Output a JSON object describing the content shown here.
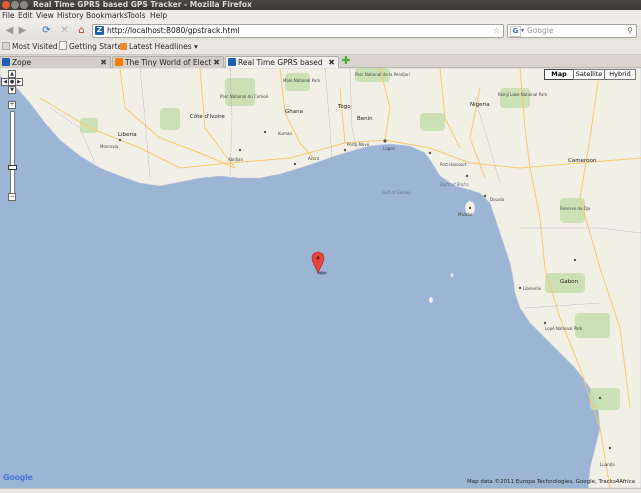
{
  "window": {
    "title": "Real Time GPRS based GPS Tracker - Mozilla Firefox"
  },
  "menu": [
    "File",
    "Edit",
    "View",
    "History",
    "Bookmarks",
    "Tools",
    "Help"
  ],
  "nav": {
    "url": "http://localhost:8080/gpstrack.html",
    "search_placeholder": "Google"
  },
  "bookmarks": [
    {
      "label": "Most Visited",
      "icon": "most-visited-icon",
      "has_dropdown": true
    },
    {
      "label": "Getting Started",
      "icon": "page-icon",
      "has_dropdown": false
    },
    {
      "label": "Latest Headlines",
      "icon": "rss-icon",
      "has_dropdown": true
    }
  ],
  "tabs": [
    {
      "label": "Zope",
      "icon": "zope-icon",
      "active": false
    },
    {
      "label": "The Tiny World of Electron...",
      "icon": "blogger-icon",
      "active": false
    },
    {
      "label": "Real Time GPRS based GP...",
      "icon": "gps-page-icon",
      "active": true
    }
  ],
  "map": {
    "type_buttons": [
      {
        "label": "Map",
        "selected": true
      },
      {
        "label": "Satellite",
        "selected": false
      },
      {
        "label": "Hybrid",
        "selected": false
      }
    ],
    "logo": "Google",
    "credit": "Map data ©2011 Europa Technologies, Google, Tracks4Africa",
    "zoom_level_fraction": 0.35,
    "colors": {
      "water": "#9db5d5",
      "land": "#f2efe6",
      "park": "#c8dfb0",
      "road": "#f7c96a"
    },
    "labels": {
      "countries": [
        "Ghana",
        "Cameroon",
        "Liberia",
        "Côte d'Ivoire",
        "Nigeria",
        "Benin",
        "Togo",
        "Gabon"
      ],
      "cities": [
        "Accra",
        "Lagos",
        "Abidjan",
        "Kumasi",
        "Monrovia",
        "Porto-Novo",
        "Douala",
        "Libreville",
        "Malabo",
        "Port Harcourt",
        "Luanda"
      ],
      "water": [
        "Gulf of Guinea",
        "Bight of Biafra"
      ],
      "parks": [
        "Parc National du Comoé",
        "Mole National Park",
        "Parc National de la Pendjari",
        "Kainji Lake National Park",
        "Reserve du Dja",
        "Lopé National Park"
      ]
    }
  }
}
